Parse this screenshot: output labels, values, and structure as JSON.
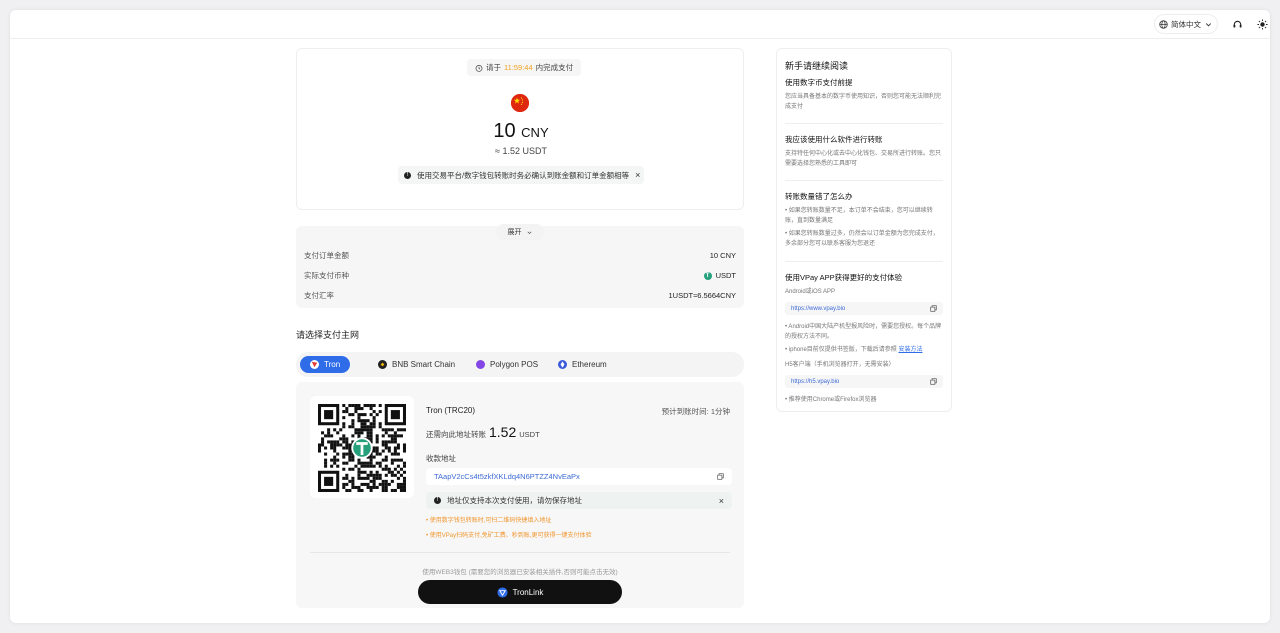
{
  "topbar": {
    "language": "简体中文",
    "support_icon": "headset-icon",
    "theme_icon": "sun-icon"
  },
  "order": {
    "timer_prefix": "请于",
    "timer_value": "11:59:44",
    "timer_suffix": "内完成支付",
    "amount": "10",
    "currency": "CNY",
    "approx": "≈ 1.52 USDT",
    "warning": "使用交易平台/数字钱包转账时务必确认到账金额和订单金额相等"
  },
  "details": {
    "expand_label": "展开",
    "rows": [
      {
        "label": "支付订单金额",
        "value": "10 CNY"
      },
      {
        "label": "实际支付币种",
        "value": "USDT"
      },
      {
        "label": "支付汇率",
        "value": "1USDT≈6.5664CNY"
      }
    ]
  },
  "networks": {
    "title": "请选择支付主网",
    "tabs": [
      {
        "label": "Tron",
        "color": "#e53935"
      },
      {
        "label": "BNB Smart Chain",
        "color": "#f0b90b"
      },
      {
        "label": "Polygon POS",
        "color": "#8247e5"
      },
      {
        "label": "Ethereum",
        "color": "#3b5bdb"
      }
    ]
  },
  "payment": {
    "network_name": "Tron (TRC20)",
    "eta_label": "预计到账时间:",
    "eta_value": "1分钟",
    "send_prefix": "还需向此地址转账",
    "send_amount": "1.52",
    "send_unit": "USDT",
    "address_label": "收款地址",
    "address": "TAapV2cCs4t5zkfXKLdq4N6PTZZ4NvEaPx",
    "address_warning": "地址仅支持本次支付使用，请勿保存地址",
    "tips": [
      "• 使用数字钱包转账时,可扫二维码快捷填入地址",
      "• 使用VPay扫码支付,免矿工费、秒到账,更可获得一键支付体验"
    ],
    "web3_note": "使用WEB3钱包 (需要您的浏览器已安装相关插件,否则可能点击无效)",
    "tronlink_label": "TronLink"
  },
  "side": {
    "title": "新手请继续阅读",
    "sections": [
      {
        "title": "使用数字币支付前提",
        "body": "您应当具备基本的数字币使用知识，否则您可能无法顺利完成支付"
      },
      {
        "title": "我应该使用什么软件进行转账",
        "body": "支持特任何中心化或去中心化钱包、交易所进行转账。您只需要选择您熟悉的工具即可"
      },
      {
        "title": "转账数量错了怎么办",
        "bullets": [
          "• 如果您转账数量不足，本订单不会结束，您可以继续转账，直到数量满足",
          "• 如果您转账数量过多，仍然会以订单金额为您完成支付，多余部分您可以联系客服为您退还"
        ]
      }
    ],
    "app_title": "使用VPay APP获得更好的支付体验",
    "app_sub": "Android或iOS APP",
    "app_link": "https://www.vpay.bio",
    "app_notes": [
      "• Android中国大陆产机型报风险时，需要您授权。每个品牌的授权方法不同。",
      "• iphone目前仅提供书签版，下载后请参照"
    ],
    "install_link": "安装方法",
    "h5_title": "H5客户端（手机浏览器打开，无需安装）",
    "h5_link": "https://h5.vpay.bio",
    "h5_note": "• 推荐使用Chrome或Firefox浏览器"
  }
}
